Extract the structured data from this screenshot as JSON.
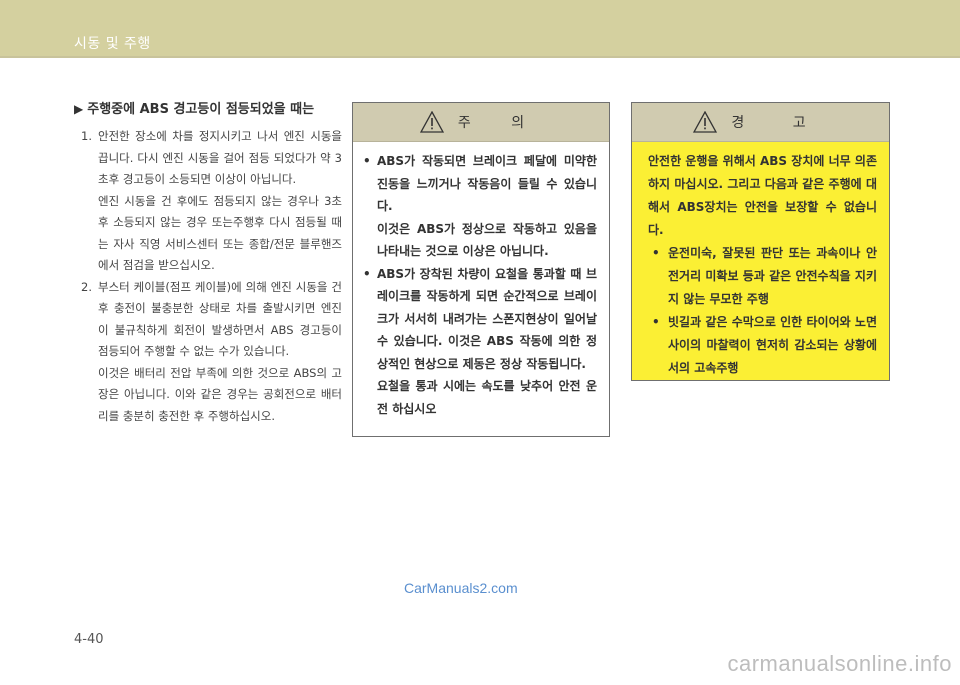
{
  "header": {
    "title": "시동 및 주행"
  },
  "left": {
    "section_title": "주행중에 ABS 경고등이 점등되었을 때는",
    "items": [
      {
        "num": "1.",
        "paragraphs": [
          "안전한 장소에 차를 정지시키고 나서 엔진 시동을 끕니다. 다시 엔진 시동을 걸어 점등 되었다가 약 3초후 경고등이 소등되면 이상이 아닙니다.",
          "엔진 시동을 건 후에도 점등되지 않는 경우나 3초후 소등되지 않는 경우 또는주행후 다시 점등될 때는 자사 직영 서비스센터 또는 종합/전문 블루핸즈에서 점검을 받으십시오."
        ]
      },
      {
        "num": "2.",
        "paragraphs": [
          "부스터 케이블(점프 케이블)에 의해 엔진 시동을 건 후 충전이 불충분한 상태로 차를 출발시키면 엔진이 불규칙하게 회전이 발생하면서 ABS 경고등이 점등되어 주행할 수 없는 수가 있습니다.",
          "이것은 배터리 전압 부족에 의한 것으로 ABS의 고장은 아닙니다. 이와 같은 경우는 공회전으로 배터리를 충분히 충전한 후 주행하십시오."
        ]
      }
    ]
  },
  "caution": {
    "title": "주 의",
    "bullets": [
      {
        "paragraphs": [
          "ABS가 작동되면 브레이크 페달에 미약한 진동을 느끼거나 작동음이 들릴 수 있습니다.",
          "이것은 ABS가 정상으로 작동하고 있음을 나타내는 것으로 이상은 아닙니다."
        ]
      },
      {
        "paragraphs": [
          "ABS가 장착된 차량이 요철을 통과할 때 브레이크를 작동하게 되면 순간적으로 브레이크가 서서히 내려가는 스폰지현상이 일어날 수 있습니다. 이것은 ABS 작동에 의한 정상적인 현상으로 제동은 정상 작동됩니다.",
          "요철을 통과 시에는 속도를 낮추어 안전 운전 하십시오"
        ]
      }
    ]
  },
  "warning": {
    "title": "경 고",
    "intro": "안전한 운행을 위해서 ABS 장치에 너무 의존하지 마십시오. 그리고 다음과 같은 주행에 대해서 ABS장치는 안전을 보장할 수 없습니다.",
    "bullets": [
      "운전미숙, 잘못된 판단 또는 과속이나 안전거리 미확보 등과 같은 안전수칙을 지키지 않는 무모한 주행",
      "빗길과 같은 수막으로 인한 타이어와 노면사이의 마찰력이 현저히 감소되는 상황에서의 고속주행"
    ]
  },
  "watermark": "CarManuals2.com",
  "page_number": "4-40",
  "footer_site": "carmanualsonline.info",
  "colors": {
    "header": "#d4d09f",
    "warning_bg": "#fbef34",
    "box_head": "#d0cbb0"
  }
}
